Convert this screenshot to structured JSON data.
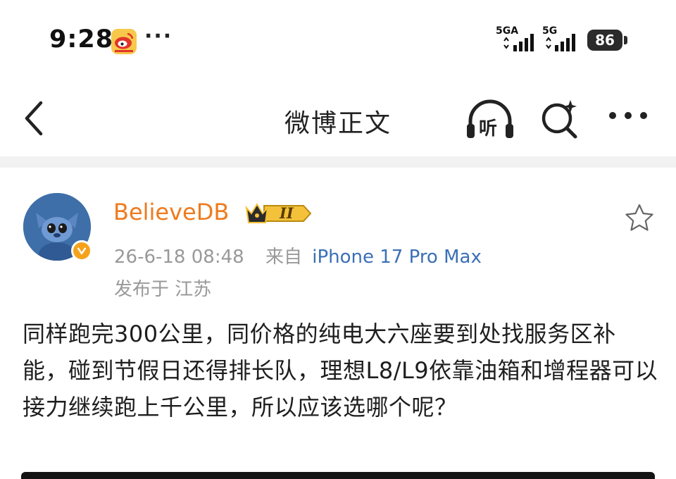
{
  "status_bar": {
    "time": "9:28",
    "more_dots": "···",
    "signal_1_label": "5GA",
    "signal_2_label": "5G",
    "battery": "86"
  },
  "nav": {
    "title": "微博正文",
    "listen_label": "听"
  },
  "post": {
    "username": "BelieveDB",
    "member_level": "II",
    "date": "26-6-18 08:48",
    "source_prefix": "来自",
    "device": "iPhone 17 Pro Max",
    "location": "发布于 江苏",
    "text": "同样跑完300公里，同价格的纯电大六座要到处找服务区补能，碰到节假日还得排长队，理想L8/L9依靠油箱和增程器可以接力继续跑上千公里，所以应该选哪个呢？"
  },
  "colors": {
    "username": "#ee7b1d",
    "device_link": "#3b6fb6",
    "meta_gray": "#999999",
    "divider": "#f2f2f2"
  },
  "icons": [
    "weibo-app-icon",
    "signal-icon",
    "battery-icon",
    "back-icon",
    "listen-icon",
    "search-icon",
    "more-icon",
    "avatar",
    "verified-badge-icon",
    "member-crown-icon",
    "star-icon"
  ]
}
